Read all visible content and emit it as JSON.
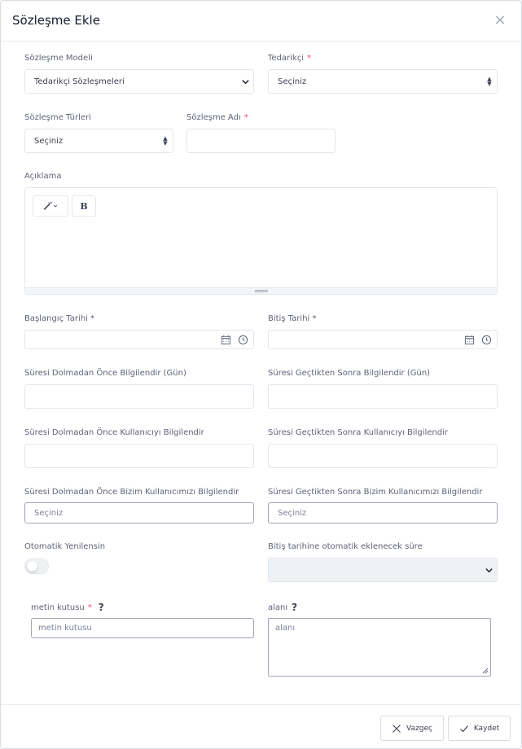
{
  "modal": {
    "title": "Sözleşme Ekle",
    "close_glyph": "×"
  },
  "form": {
    "contract_model": {
      "label": "Sözleşme Modeli",
      "value": "Tedarikçi Sözleşmeleri"
    },
    "supplier": {
      "label": "Tedarikçi",
      "required": "*",
      "value": "Seçiniz"
    },
    "contract_types": {
      "label": "Sözleşme Türleri",
      "value": "Seçiniz"
    },
    "contract_name": {
      "label": "Sözleşme Adı",
      "required": "*",
      "value": ""
    },
    "description": {
      "label": "Açıklama",
      "bold_label": "B",
      "magic_icon": "magic-wand-icon"
    },
    "start_date": {
      "label": "Başlangıç Tarihi *",
      "value": ""
    },
    "end_date": {
      "label": "Bitiş Tarihi *",
      "value": ""
    },
    "notify_before_days": {
      "label": "Süresi Dolmadan Önce Bilgilendir (Gün)",
      "value": ""
    },
    "notify_after_days": {
      "label": "Süresi Geçtikten Sonra Bilgilendir (Gün)",
      "value": ""
    },
    "notify_user_before": {
      "label": "Süresi Dolmadan Önce Kullanıcıyı Bilgilendir",
      "value": ""
    },
    "notify_user_after": {
      "label": "Süresi Geçtikten Sonra Kullanıcıyı Bilgilendir",
      "value": ""
    },
    "notify_our_user_before": {
      "label": "Süresi Dolmadan Önce Bizim Kullanıcımızı Bilgilendir",
      "placeholder": "Seçiniz"
    },
    "notify_our_user_after": {
      "label": "Süresi Geçtikten Sonra Bizim Kullanıcımızı Bilgilendir",
      "placeholder": "Seçiniz"
    },
    "auto_renew": {
      "label": "Otomatik Yenilensin",
      "checked": false
    },
    "auto_add_period": {
      "label": "Bitiş tarihine otomatik eklenecek süre",
      "value": ""
    },
    "text_box": {
      "label": "metin kutusu",
      "required": "*",
      "help": "?",
      "placeholder": "metin kutusu"
    },
    "area": {
      "label": "alanı",
      "help": "?",
      "placeholder": "alanı"
    }
  },
  "footer": {
    "cancel_label": "Vazgeç",
    "save_label": "Kaydet"
  },
  "colors": {
    "required": "#f1416c",
    "border": "#e4e6ef",
    "text": "#3f4254"
  }
}
